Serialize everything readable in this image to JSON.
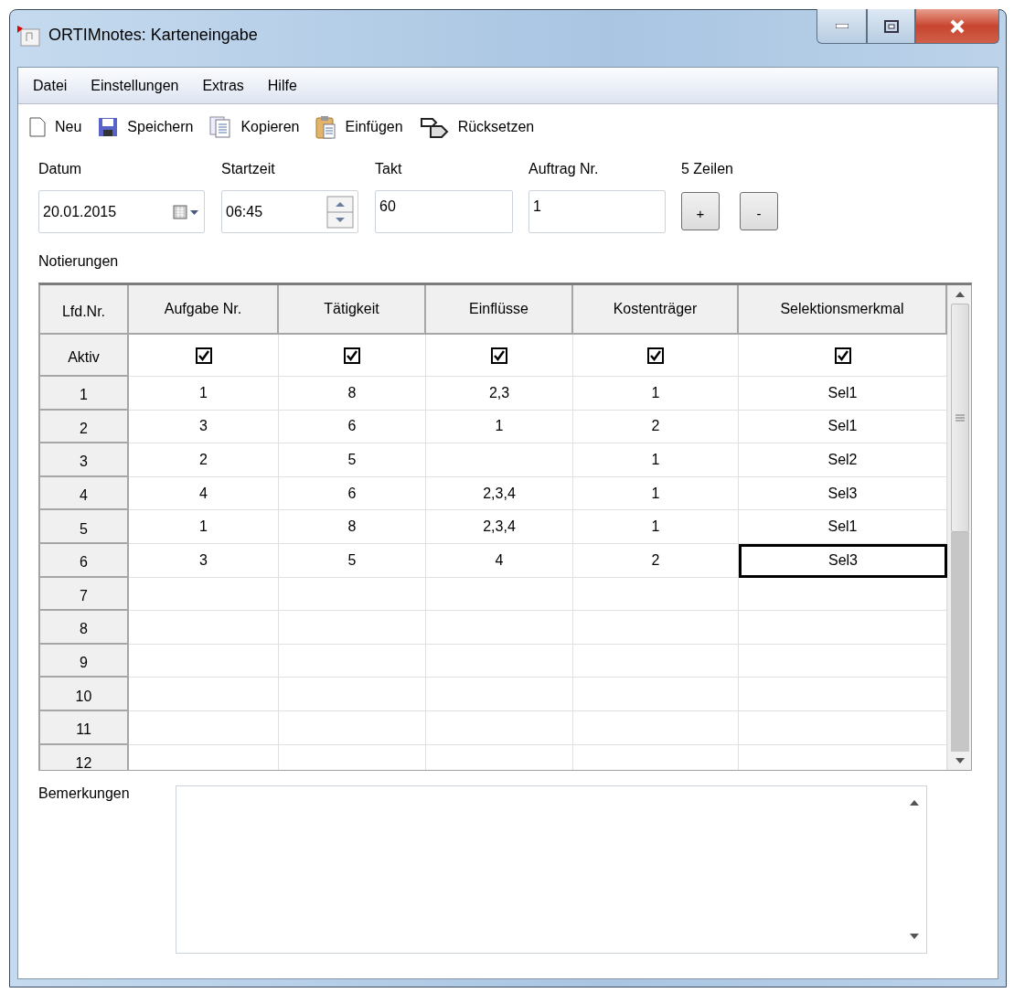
{
  "window": {
    "title": "ORTIMnotes: Karteneingabe"
  },
  "menu": [
    "Datei",
    "Einstellungen",
    "Extras",
    "Hilfe"
  ],
  "toolbar": [
    {
      "kind": "new",
      "label": "Neu"
    },
    {
      "kind": "save",
      "label": "Speichern"
    },
    {
      "kind": "copy",
      "label": "Kopieren"
    },
    {
      "kind": "paste",
      "label": "Einfügen"
    },
    {
      "kind": "reset",
      "label": "Rücksetzen"
    }
  ],
  "form": {
    "date": {
      "label": "Datum",
      "value": "20.01.2015"
    },
    "start": {
      "label": "Startzeit",
      "value": "06:45"
    },
    "takt": {
      "label": "Takt",
      "value": "60"
    },
    "order": {
      "label": "Auftrag Nr.",
      "value": "1"
    },
    "lines": {
      "label": "5 Zeilen",
      "buttons": [
        "+",
        "-"
      ]
    }
  },
  "grid": {
    "title": "Notierungen",
    "corner": "Lfd.Nr.",
    "columns": [
      "Aufgabe Nr.",
      "Tätigkeit",
      "Einflüsse",
      "Kostenträger",
      "Selektionsmerkmal"
    ],
    "active_row": {
      "label": "Aktiv",
      "checks": [
        {
          "checked": true
        },
        {
          "checked": true
        },
        {
          "checked": true
        },
        {
          "checked": true
        },
        {
          "checked": true
        }
      ]
    },
    "rows": [
      {
        "number": "1",
        "cells": [
          {
            "text": "1",
            "selected": false
          },
          {
            "text": "8",
            "selected": false
          },
          {
            "text": "2,3",
            "selected": false
          },
          {
            "text": "1",
            "selected": false
          },
          {
            "text": "Sel1",
            "selected": false
          }
        ]
      },
      {
        "number": "2",
        "cells": [
          {
            "text": "3",
            "selected": false
          },
          {
            "text": "6",
            "selected": false
          },
          {
            "text": "1",
            "selected": false
          },
          {
            "text": "2",
            "selected": false
          },
          {
            "text": "Sel1",
            "selected": false
          }
        ]
      },
      {
        "number": "3",
        "cells": [
          {
            "text": "2",
            "selected": false
          },
          {
            "text": "5",
            "selected": false
          },
          {
            "selected": false
          },
          {
            "text": "1",
            "selected": false
          },
          {
            "text": "Sel2",
            "selected": false
          }
        ]
      },
      {
        "number": "4",
        "cells": [
          {
            "text": "4",
            "selected": false
          },
          {
            "text": "6",
            "selected": false
          },
          {
            "text": "2,3,4",
            "selected": false
          },
          {
            "text": "1",
            "selected": false
          },
          {
            "text": "Sel3",
            "selected": false
          }
        ]
      },
      {
        "number": "5",
        "cells": [
          {
            "text": "1",
            "selected": false
          },
          {
            "text": "8",
            "selected": false
          },
          {
            "text": "2,3,4",
            "selected": false
          },
          {
            "text": "1",
            "selected": false
          },
          {
            "text": "Sel1",
            "selected": false
          }
        ]
      },
      {
        "number": "6",
        "cells": [
          {
            "text": "3",
            "selected": false
          },
          {
            "text": "5",
            "selected": false
          },
          {
            "text": "4",
            "selected": false
          },
          {
            "text": "2",
            "selected": false
          },
          {
            "text": "Sel3",
            "selected": true
          }
        ]
      },
      {
        "number": "7"
      },
      {
        "number": "8"
      },
      {
        "number": "9"
      },
      {
        "number": "10"
      },
      {
        "number": "11"
      },
      {
        "number": "12"
      }
    ]
  },
  "remarks": {
    "label": "Bemerkungen"
  }
}
